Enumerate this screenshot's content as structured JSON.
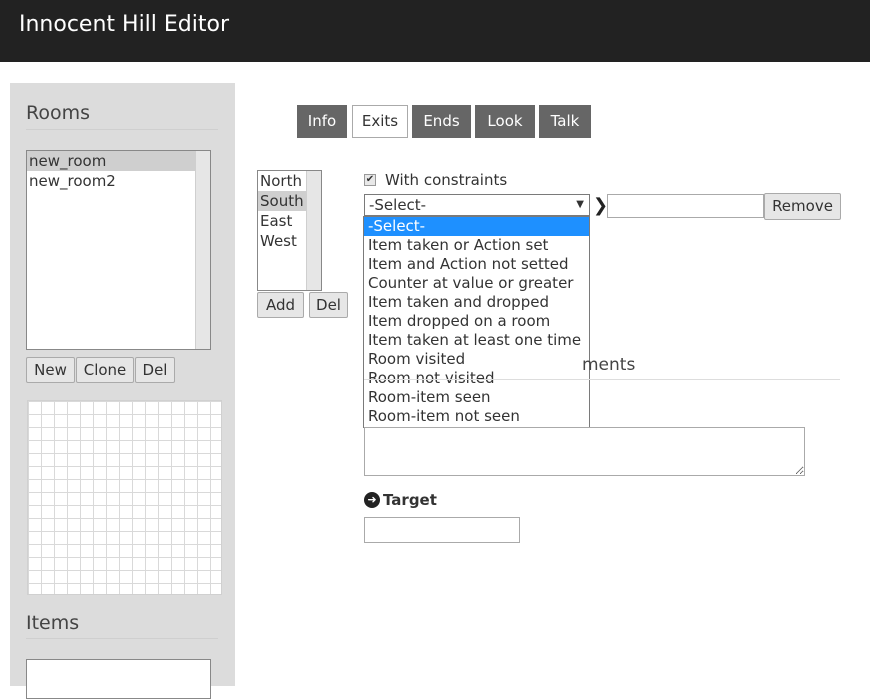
{
  "app": {
    "title": "Innocent Hill Editor"
  },
  "sidebar": {
    "rooms_heading": "Rooms",
    "rooms": [
      "new_room",
      "new_room2"
    ],
    "selected_room": "new_room",
    "buttons": {
      "new": "New",
      "clone": "Clone",
      "del": "Del"
    },
    "items_heading": "Items"
  },
  "tabs": [
    "Info",
    "Exits",
    "Ends",
    "Look",
    "Talk"
  ],
  "active_tab": "Exits",
  "exits": {
    "list": [
      "North",
      "South",
      "East",
      "West"
    ],
    "selected": "South",
    "add_label": "Add",
    "del_label": "Del"
  },
  "constraints": {
    "checkbox_label": "With constraints",
    "checked": true,
    "select_value": "-Select-",
    "options": [
      "-Select-",
      "Item taken or Action set",
      "Item and Action not setted",
      "Counter at value or greater",
      "Item taken and dropped",
      "Item dropped on a room",
      "Item taken at least one time",
      "Room visited",
      "Room not visited",
      "Room-item seen",
      "Room-item not seen"
    ],
    "highlighted_option": "-Select-",
    "value_input": "",
    "remove_label": "Remove"
  },
  "comments": {
    "heading_visible": "ments",
    "textarea_value": ""
  },
  "target": {
    "label": "Target",
    "input_value": ""
  },
  "icons": {
    "chevron": "chevron-right-icon",
    "target": "arrow-circle-right-icon",
    "checkbox": "check-icon"
  }
}
